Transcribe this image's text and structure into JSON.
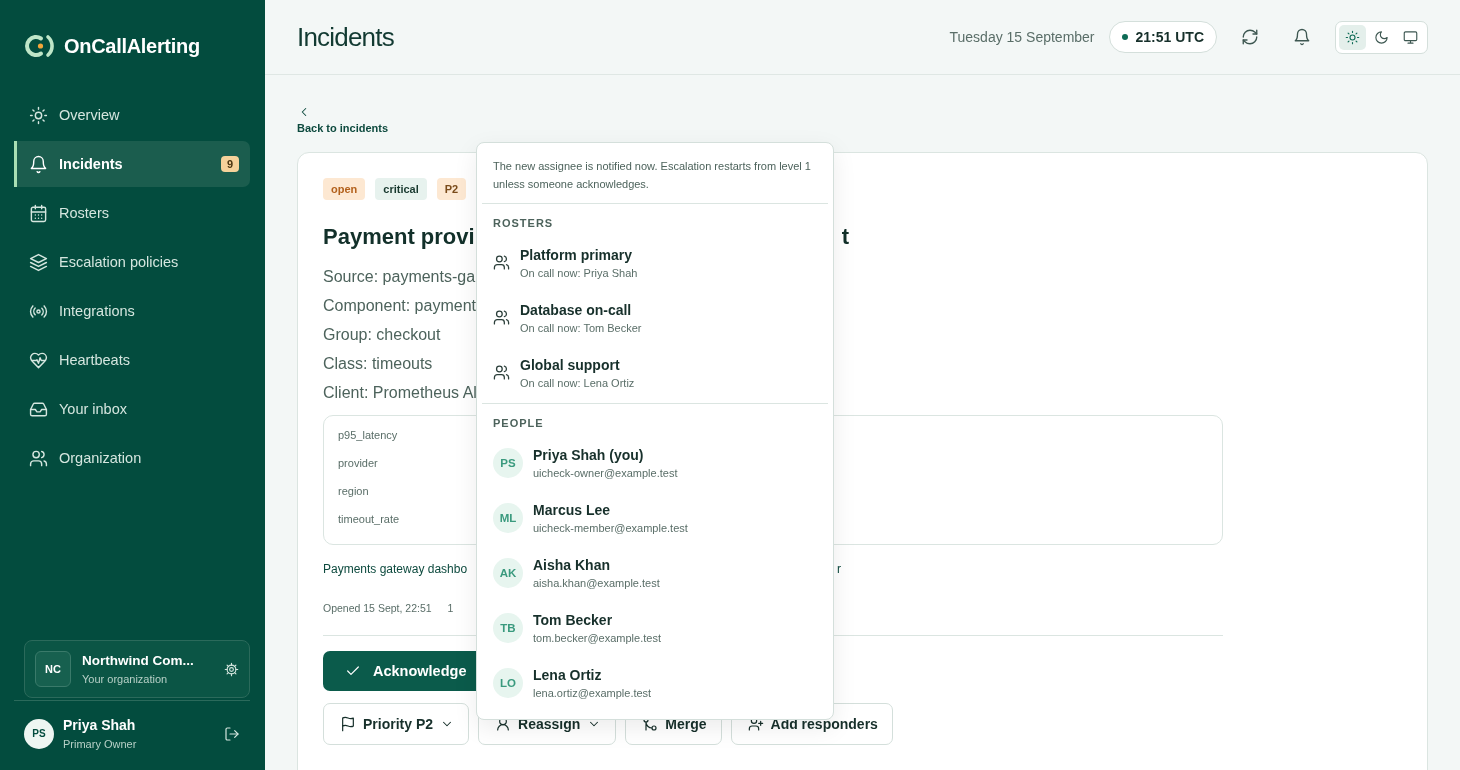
{
  "app": {
    "name": "OnCallAlerting"
  },
  "sidebar": {
    "items": [
      {
        "label": "Overview",
        "selected": false
      },
      {
        "label": "Incidents",
        "selected": true,
        "badge": "9"
      },
      {
        "label": "Rosters",
        "selected": false
      },
      {
        "label": "Escalation policies",
        "selected": false
      },
      {
        "label": "Integrations",
        "selected": false
      },
      {
        "label": "Heartbeats",
        "selected": false
      },
      {
        "label": "Your inbox",
        "selected": false
      },
      {
        "label": "Organization",
        "selected": false
      }
    ],
    "organization": {
      "initials": "NC",
      "name": "Northwind Com...",
      "subtitle": "Your organization"
    },
    "user": {
      "initials": "PS",
      "name": "Priya Shah",
      "role": "Primary Owner"
    }
  },
  "header": {
    "title": "Incidents",
    "date": "Tuesday 15 September",
    "time": "21:51 UTC",
    "theme_options": [
      {
        "kind": "light",
        "selected": true
      },
      {
        "kind": "dark",
        "selected": false
      },
      {
        "kind": "system",
        "selected": false
      }
    ]
  },
  "back_link": {
    "label": "Back to incidents"
  },
  "incident": {
    "tags": [
      {
        "label": "open",
        "kind": "status"
      },
      {
        "label": "critical",
        "kind": "severity"
      },
      {
        "label": "P2",
        "kind": "priority"
      }
    ],
    "title_start": "Payment provi",
    "title_end": "t",
    "details": [
      "Source: payments-ga",
      "Component: payment",
      "Group: checkout",
      "Class: timeouts",
      "Client: Prometheus Al"
    ],
    "fields": [
      "p95_latency",
      "provider",
      "region",
      "timeout_rate"
    ],
    "link_start": "Payments gateway dashbo",
    "link_end": "r",
    "opened": "Opened 15 Sept, 22:51",
    "meta_2": "1",
    "primary_action": {
      "label": "Acknowledge"
    },
    "actions": [
      {
        "label": "Priority P2",
        "dropdown": true
      },
      {
        "label": "Reassign",
        "dropdown": true
      },
      {
        "label": "Merge",
        "dropdown": false
      },
      {
        "label": "Add responders",
        "dropdown": false
      }
    ]
  },
  "reassign_menu": {
    "note": "The new assignee is notified now. Escalation restarts from level 1 unless someone acknowledges.",
    "sections": [
      {
        "heading": "ROSTERS",
        "kind": "roster",
        "items": [
          {
            "name": "Platform primary",
            "detail": "On call now: Priya Shah"
          },
          {
            "name": "Database on-call",
            "detail": "On call now: Tom Becker"
          },
          {
            "name": "Global support",
            "detail": "On call now: Lena Ortiz"
          }
        ]
      },
      {
        "heading": "PEOPLE",
        "kind": "person",
        "items": [
          {
            "initials": "PS",
            "name": "Priya Shah (you)",
            "detail": "uicheck-owner@example.test"
          },
          {
            "initials": "ML",
            "name": "Marcus Lee",
            "detail": "uicheck-member@example.test"
          },
          {
            "initials": "AK",
            "name": "Aisha Khan",
            "detail": "aisha.khan@example.test"
          },
          {
            "initials": "TB",
            "name": "Tom Becker",
            "detail": "tom.becker@example.test"
          },
          {
            "initials": "LO",
            "name": "Lena Ortiz",
            "detail": "lena.ortiz@example.test"
          }
        ]
      }
    ]
  }
}
